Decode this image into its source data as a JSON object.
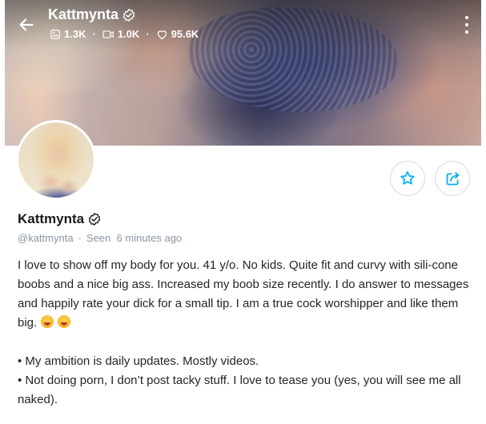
{
  "header": {
    "title": "Kattmynta",
    "stats": [
      {
        "icon": "image-icon",
        "value": "1.3K"
      },
      {
        "icon": "video-icon",
        "value": "1.0K"
      },
      {
        "icon": "heart-icon",
        "value": "95.6K"
      }
    ],
    "separator": "·"
  },
  "profile": {
    "name": "Kattmynta",
    "handle": "@kattmynta",
    "separator": "·",
    "last_seen": "Seen  6 minutes ago",
    "verified_icon": "verified-badge-icon"
  },
  "bio": {
    "paragraph_1": "I love to show off my body for you. 41 y/o. No kids. Quite fit and curvy with sili-cone boobs and a nice big ass. Increased my boob size recently. I do answer to messages and happily rate your dick for a small tip. I am a true cock worshipper and like them big.",
    "emojis": [
      "tongue-out-emoji",
      "yum-emoji"
    ],
    "bullet_1": "• My ambition is daily updates. Mostly videos.",
    "bullet_2": "• Not doing porn, I don’t post tacky stuff. I love to tease you (yes, you will see me all naked)."
  },
  "actions": {
    "favorite_icon": "star-icon",
    "share_icon": "share-icon"
  },
  "colors": {
    "accent": "#00aff0",
    "muted": "#8a96a3",
    "text": "#242529"
  }
}
